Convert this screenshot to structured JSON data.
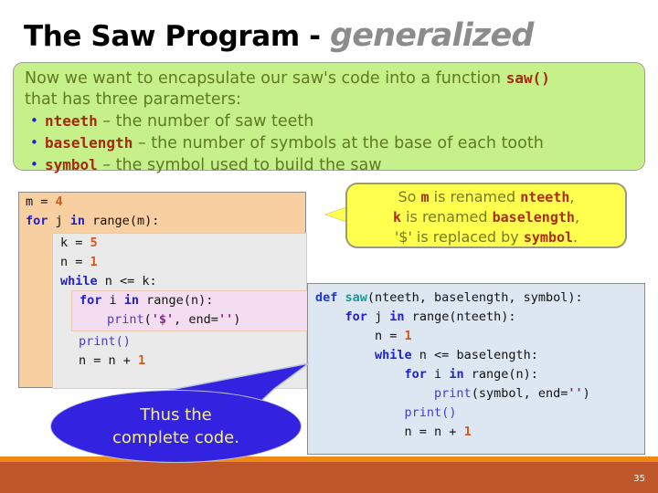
{
  "slide": {
    "page_number": "35",
    "title": {
      "main": "The Saw Program - ",
      "emphasis": "generalized"
    },
    "accent_colors": {
      "green_box_bg": "#c6f08a",
      "yellow_box_bg": "#ffff4d",
      "blue_ellipse_bg": "#3322e0",
      "orange_code_bg": "#f8cfa0",
      "gray_code_bg": "#eaeaea",
      "pink_code_bg": "#f4ddf0",
      "blue_code_bg": "#dde7f2",
      "bottom_bar": "#c0572a",
      "bottom_stripe": "#f08a16"
    }
  },
  "green_box": {
    "line1_a": "Now we want to encapsulate our saw's code into a function ",
    "line1_code": "saw()",
    "line2": "that has three parameters:",
    "bullet_char": "•",
    "bullets": [
      {
        "code": "nteeth",
        "text": " – the number of saw teeth"
      },
      {
        "code": "baselength",
        "text": " – the number of symbols at the base of each tooth"
      },
      {
        "code": "symbol",
        "text": " – the symbol used to build the saw"
      }
    ]
  },
  "yellow_box": {
    "line1_a": "So ",
    "line1_m": "m",
    "line1_b": " is renamed ",
    "line1_c": "nteeth",
    "line1_d": ",",
    "line2_a": "",
    "line2_k": "k",
    "line2_b": " is renamed ",
    "line2_c": "baselength",
    "line2_d": ",",
    "line3_a": "'$' is replaced by ",
    "line3_c": "symbol",
    "line3_d": "."
  },
  "blue_ellipse": {
    "line1": "Thus the",
    "line2": "complete code."
  },
  "left_code": {
    "outer": {
      "l1_var": "m",
      "l1_eq": " = ",
      "l1_num": "4",
      "l2_for": "for",
      "l2_j": " j ",
      "l2_in": "in",
      "l2_rest": " range(m):"
    },
    "mid": {
      "l1": "k = ",
      "l1_num": "5",
      "l2": "n = ",
      "l2_num": "1",
      "l3_while": "while",
      "l3_rest": " n <= k:",
      "l4_print": "print()",
      "l5": "n = n + ",
      "l5_num": "1"
    },
    "inner": {
      "l1_for": "for",
      "l1_i": " i ",
      "l1_in": "in",
      "l1_rest": " range(n):",
      "l2_print": "print",
      "l2_open": "(",
      "l2_str": "'$'",
      "l2_mid": ", end=",
      "l2_str2": "''",
      "l2_close": ")"
    }
  },
  "right_code": {
    "l1_def": "def",
    "l1_name": " saw",
    "l1_args": "(nteeth, baselength, symbol):",
    "l2_for": "    for",
    "l2_j": " j ",
    "l2_in": "in",
    "l2_rest": " range(nteeth):",
    "l3": "        n = ",
    "l3_num": "1",
    "l4_while": "        while",
    "l4_rest": " n <= baselength:",
    "l5_for": "            for",
    "l5_i": " i ",
    "l5_in": "in",
    "l5_rest": " range(n):",
    "l6_ind": "                ",
    "l6_print": "print",
    "l6_rest": "(symbol, end=",
    "l6_str": "''",
    "l6_close": ")",
    "l7_ind": "            ",
    "l7_print": "print()",
    "l8": "            n = n + ",
    "l8_num": "1"
  }
}
